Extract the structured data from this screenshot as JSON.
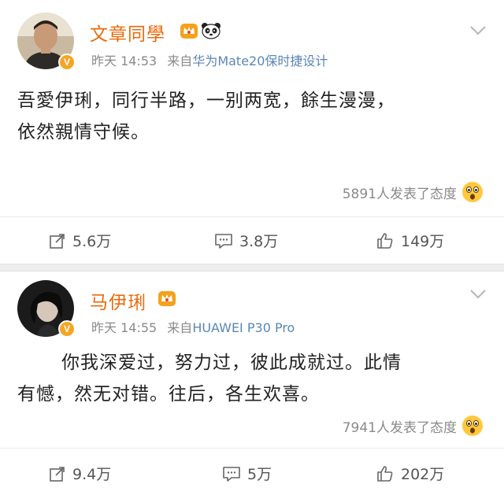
{
  "posts": [
    {
      "author": "文章同學",
      "time": "昨天 14:53",
      "source_prefix": "来自",
      "source": "华为Mate20保时捷设计",
      "content_line1": "吾愛伊琍，同行半路，一别两宽，餘生漫漫，",
      "content_line2": "依然親情守候。",
      "reactions": "5891人发表了态度",
      "repost": "5.6万",
      "comment": "3.8万",
      "like": "149万"
    },
    {
      "author": "马伊琍",
      "time": "昨天 14:55",
      "source_prefix": "来自",
      "source": "HUAWEI P30 Pro",
      "content_line1": "你我深爱过，努力过，彼此成就过。此情",
      "content_line2": "有憾，然无对错。往后，各生欢喜。",
      "reactions": "7941人发表了态度",
      "repost": "9.4万",
      "comment": "5万",
      "like": "202万"
    }
  ],
  "colors": {
    "author_name": "#e86b0c",
    "source_link": "#5b86b5",
    "meta_gray": "#8a8a8a",
    "verified_badge": "#f5a623"
  },
  "icons": {
    "verified": "V",
    "repost": "repost-icon",
    "comment": "comment-icon",
    "like": "thumbs-up-icon",
    "reaction": "surprised-face-icon",
    "crown": "crown-badge-icon",
    "panda": "panda-icon",
    "more": "chevron-down-icon"
  }
}
